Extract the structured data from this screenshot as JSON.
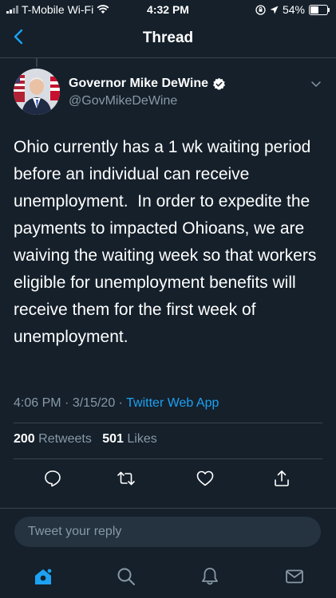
{
  "status_bar": {
    "carrier": "T-Mobile Wi-Fi",
    "time": "4:32 PM",
    "battery": "54%",
    "battery_level": 0.54
  },
  "nav": {
    "title": "Thread"
  },
  "tweet": {
    "author_name": "Governor Mike DeWine",
    "author_handle": "@GovMikeDeWine",
    "text": "Ohio currently has a 1 wk waiting period before an individual can receive unemployment.  In order to expedite the payments to impacted Ohioans, we are waiving the waiting week so that workers eligible for unemployment benefits will receive them for the first week of unemployment.",
    "time": "4:06 PM",
    "date": "3/15/20",
    "source": "Twitter Web App",
    "retweets_count": "200",
    "retweets_label": "Retweets",
    "likes_count": "501",
    "likes_label": "Likes"
  },
  "reply": {
    "placeholder": "Tweet your reply"
  },
  "colors": {
    "background": "#15202b",
    "accent": "#1da1f2",
    "secondary_text": "#8899a6"
  },
  "icons": {
    "back": "chevron-left-icon",
    "verified": "verified-badge-icon",
    "caret": "chevron-down-icon",
    "reply": "comment-icon",
    "retweet": "retweet-icon",
    "like": "heart-icon",
    "share": "share-icon",
    "home": "home-icon",
    "search": "search-icon",
    "notifications": "bell-icon",
    "messages": "envelope-icon"
  }
}
